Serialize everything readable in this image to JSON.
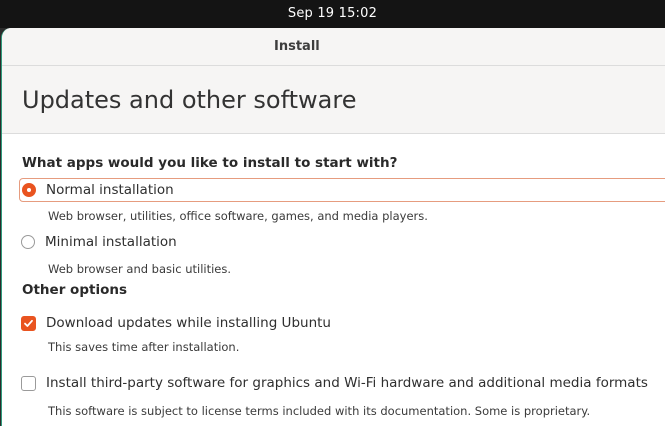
{
  "topbar": {
    "clock": "Sep 19  15:02"
  },
  "window": {
    "title": "Install"
  },
  "page": {
    "title": "Updates and other software",
    "question": "What apps would you like to install to start with?",
    "install_options": [
      {
        "label": "Normal installation",
        "description": "Web browser, utilities, office software, games, and media players.",
        "selected": true
      },
      {
        "label": "Minimal installation",
        "description": "Web browser and basic utilities.",
        "selected": false
      }
    ],
    "other_options_title": "Other options",
    "other_options": [
      {
        "label": "Download updates while installing Ubuntu",
        "description": "This saves time after installation.",
        "checked": true
      },
      {
        "label": "Install third-party software for graphics and Wi-Fi hardware and additional media formats",
        "description": "This software is subject to license terms included with its documentation. Some is proprietary.",
        "checked": false
      }
    ]
  },
  "colors": {
    "accent": "#e95420",
    "focus_border": "#e69c7f",
    "topbar": "#141414",
    "header_bg": "#f6f5f4"
  },
  "icons": {
    "checked_checkbox": "check-mark-icon"
  }
}
